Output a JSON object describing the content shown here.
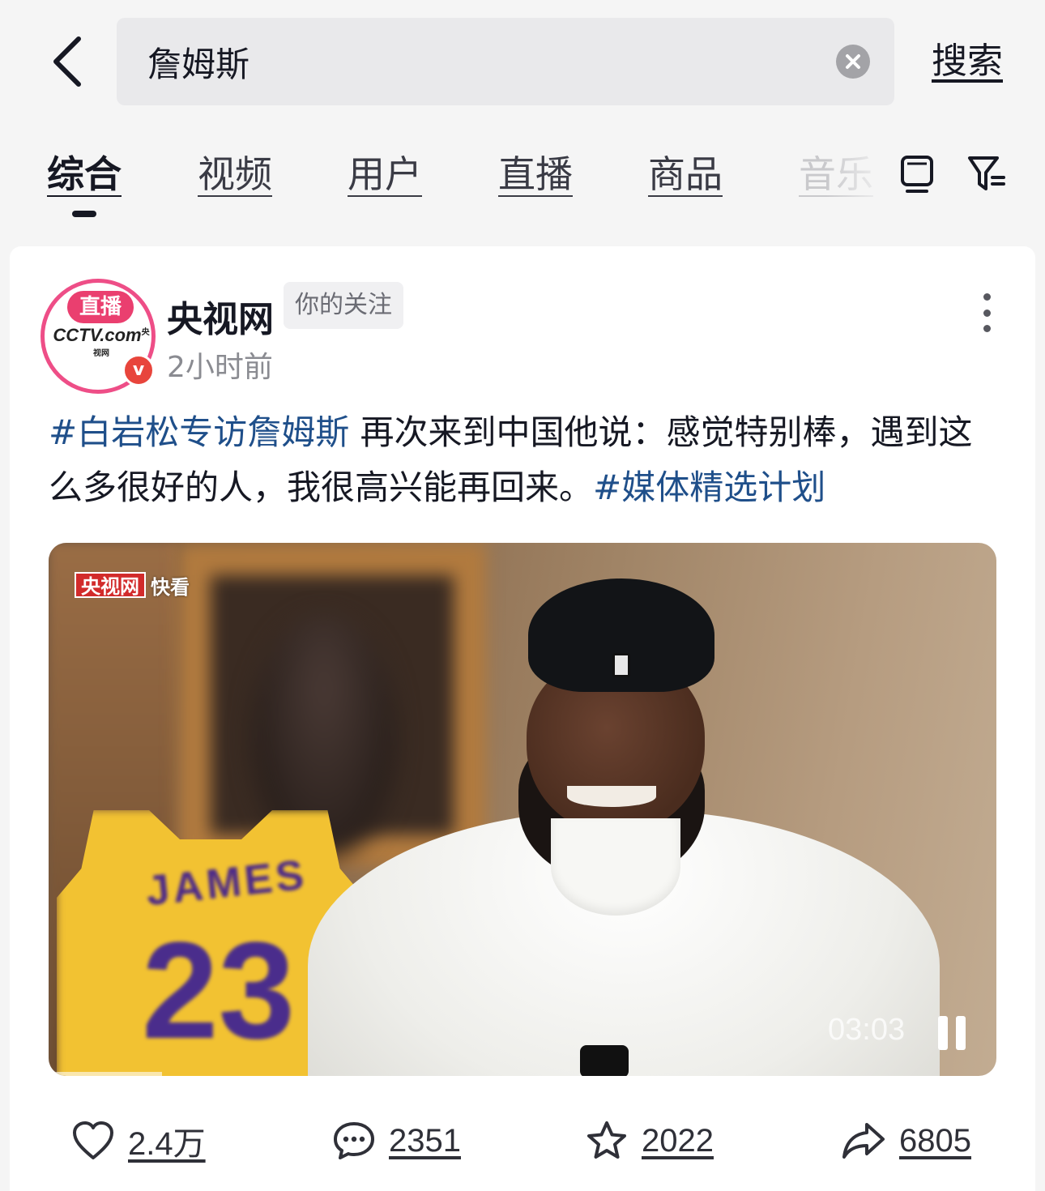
{
  "search": {
    "query": "詹姆斯",
    "submit_label": "搜索"
  },
  "tabs": [
    {
      "label": "综合",
      "active": true
    },
    {
      "label": "视频"
    },
    {
      "label": "用户"
    },
    {
      "label": "直播"
    },
    {
      "label": "商品"
    },
    {
      "label": "音乐"
    }
  ],
  "post": {
    "avatar": {
      "live_badge": "直播",
      "logo_text": "CCTV",
      "logo_suffix": ".com",
      "logo_small": "央视网",
      "verified_mark": "v"
    },
    "author": "央视网",
    "follow_tag": "你的关注",
    "time": "2小时前",
    "text": {
      "hashtag1": "#白岩松专访詹姆斯",
      "body": " 再次来到中国他说：感觉特别棒，遇到这么多很好的人，我很高兴能再回来。",
      "hashtag2": "#媒体精选计划"
    },
    "video": {
      "watermark_red": "央视网",
      "watermark_white": "快看",
      "jersey_name": "JAMES",
      "jersey_number": "23",
      "duration": "03:03",
      "progress": 0.12
    },
    "actions": {
      "likes": "2.4万",
      "comments": "2351",
      "favorites": "2022",
      "shares": "6805"
    }
  },
  "colors": {
    "hashtag": "#1f4f8a",
    "avatar_ring": "#ee4e87",
    "verified": "#e8453c",
    "watermark_red": "#d22b2b"
  },
  "icons": [
    "back-arrow-icon",
    "clear-icon",
    "tv-icon",
    "filter-icon",
    "more-icon",
    "heart-icon",
    "comment-icon",
    "star-icon",
    "share-icon",
    "pause-icon"
  ]
}
